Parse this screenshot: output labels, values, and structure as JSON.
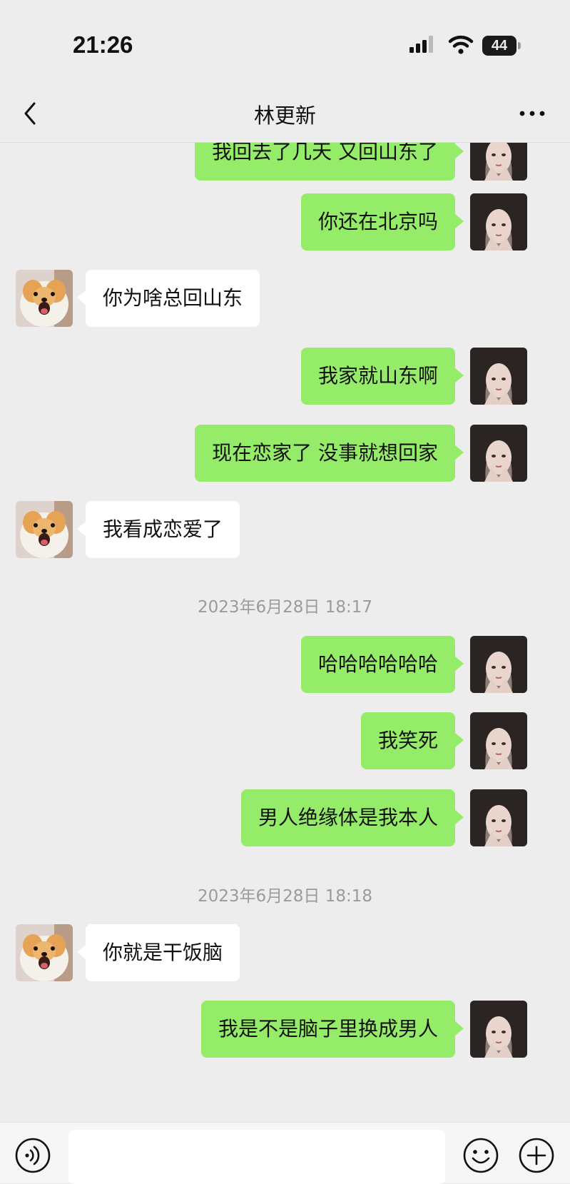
{
  "status_bar": {
    "time": "21:26",
    "battery": "44"
  },
  "header": {
    "title": "林更新"
  },
  "messages": [
    {
      "type": "message",
      "from": "me",
      "text": "我回去了几天 又回山东了"
    },
    {
      "type": "message",
      "from": "me",
      "text": "你还在北京吗"
    },
    {
      "type": "message",
      "from": "them",
      "text": "你为啥总回山东"
    },
    {
      "type": "message",
      "from": "me",
      "text": "我家就山东啊"
    },
    {
      "type": "message",
      "from": "me",
      "text": "现在恋家了 没事就想回家"
    },
    {
      "type": "message",
      "from": "them",
      "text": "我看成恋爱了"
    },
    {
      "type": "time",
      "text": "2023年6月28日 18:17"
    },
    {
      "type": "message",
      "from": "me",
      "text": "哈哈哈哈哈哈"
    },
    {
      "type": "message",
      "from": "me",
      "text": "我笑死"
    },
    {
      "type": "message",
      "from": "me",
      "text": "男人绝缘体是我本人"
    },
    {
      "type": "time",
      "text": "2023年6月28日 18:18"
    },
    {
      "type": "message",
      "from": "them",
      "text": "你就是干饭脑"
    },
    {
      "type": "message",
      "from": "me",
      "text": "我是不是脑子里换成男人"
    }
  ],
  "input": {
    "value": ""
  },
  "colors": {
    "background": "#EDEDED",
    "my_bubble": "#95EC69",
    "their_bubble": "#FFFFFF",
    "timestamp_text": "#9B9B9B"
  },
  "icons": {
    "back": "chevron-left-icon",
    "more": "more-dots-icon",
    "voice": "voice-icon",
    "emoji": "emoji-icon",
    "plus": "plus-icon"
  }
}
